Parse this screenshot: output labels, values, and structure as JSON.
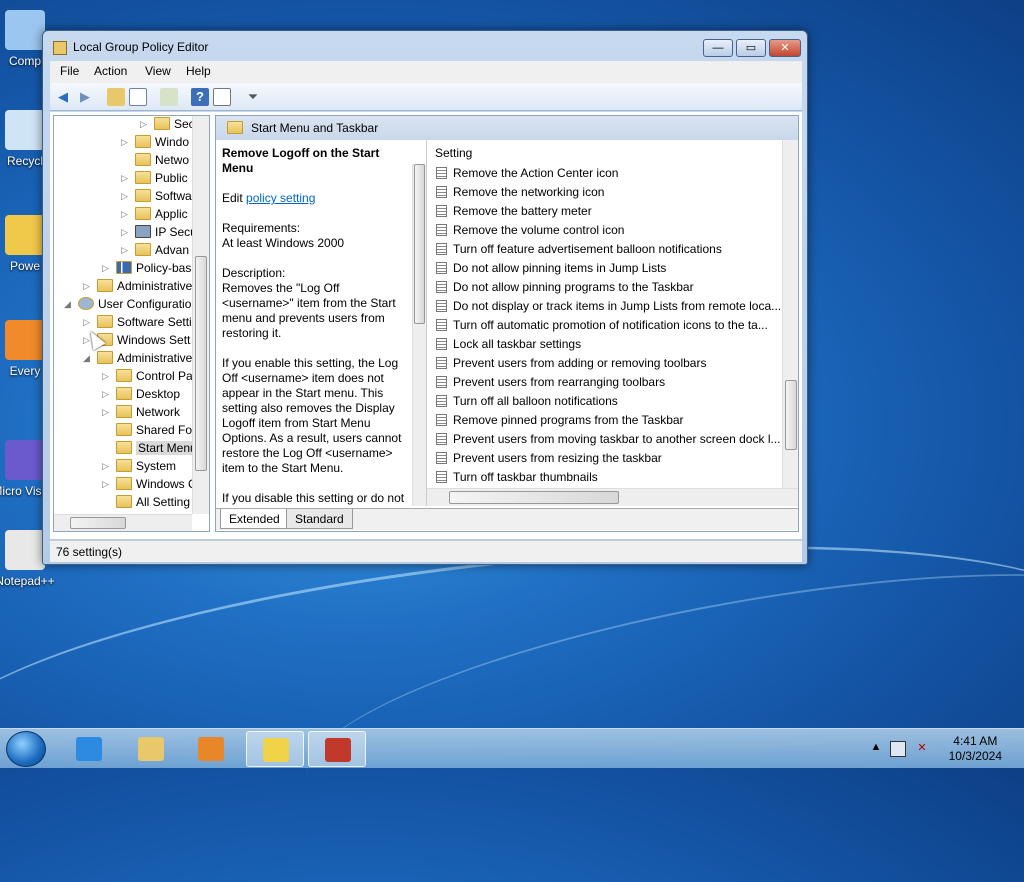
{
  "desktop": {
    "icons": [
      {
        "label": "Comp",
        "color": "#9bc6ef"
      },
      {
        "label": "Recycl",
        "color": "#cfe4f5"
      },
      {
        "label": "Powe",
        "color": "#f1c94a"
      },
      {
        "label": "Every",
        "color": "#f08a2a"
      },
      {
        "label": "Micro Visual",
        "color": "#6a5acd"
      },
      {
        "label": "Notepad++",
        "color": "#e8e8e8"
      }
    ]
  },
  "window": {
    "title": "Local Group Policy Editor",
    "min_glyph": "—",
    "max_glyph": "▭",
    "close_glyph": "✕",
    "menu": [
      "File",
      "Action",
      "View",
      "Help"
    ],
    "toolbar_icons": [
      "back-icon",
      "forward-icon",
      "up-folder-icon",
      "show-hide-tree-icon",
      "export-list-icon",
      "help-icon",
      "properties-icon",
      "filter-icon"
    ]
  },
  "tree": {
    "items": [
      {
        "label": "Sec",
        "indent": 5,
        "arrow": "▷",
        "kind": "folder-lock"
      },
      {
        "label": "Windo",
        "indent": 4,
        "arrow": "▷",
        "kind": "folder"
      },
      {
        "label": "Netwo",
        "indent": 4,
        "arrow": "",
        "kind": "folder"
      },
      {
        "label": "Public",
        "indent": 4,
        "arrow": "▷",
        "kind": "folder"
      },
      {
        "label": "Softwa",
        "indent": 4,
        "arrow": "▷",
        "kind": "folder"
      },
      {
        "label": "Applic",
        "indent": 4,
        "arrow": "▷",
        "kind": "folder"
      },
      {
        "label": "IP Secu",
        "indent": 4,
        "arrow": "▷",
        "kind": "computer"
      },
      {
        "label": "Advan",
        "indent": 4,
        "arrow": "▷",
        "kind": "folder"
      },
      {
        "label": "Policy-bas",
        "indent": 3,
        "arrow": "▷",
        "kind": "chart"
      },
      {
        "label": "Administrative",
        "indent": 2,
        "arrow": "▷",
        "kind": "folder"
      },
      {
        "label": "User Configuratio",
        "indent": 1,
        "arrow": "◢",
        "kind": "user"
      },
      {
        "label": "Software Setti",
        "indent": 2,
        "arrow": "▷",
        "kind": "folder"
      },
      {
        "label": "Windows Sett",
        "indent": 2,
        "arrow": "▷",
        "kind": "folder"
      },
      {
        "label": "Administrative",
        "indent": 2,
        "arrow": "◢",
        "kind": "folder"
      },
      {
        "label": "Control Pa",
        "indent": 3,
        "arrow": "▷",
        "kind": "folder"
      },
      {
        "label": "Desktop",
        "indent": 3,
        "arrow": "▷",
        "kind": "folder"
      },
      {
        "label": "Network",
        "indent": 3,
        "arrow": "▷",
        "kind": "folder"
      },
      {
        "label": "Shared Fol",
        "indent": 3,
        "arrow": "",
        "kind": "folder"
      },
      {
        "label": "Start Menu",
        "indent": 3,
        "arrow": "",
        "kind": "folder",
        "selected": true
      },
      {
        "label": "System",
        "indent": 3,
        "arrow": "▷",
        "kind": "folder"
      },
      {
        "label": "Windows C",
        "indent": 3,
        "arrow": "▷",
        "kind": "folder"
      },
      {
        "label": "All Setting",
        "indent": 3,
        "arrow": "",
        "kind": "folder"
      }
    ]
  },
  "pane": {
    "header": "Start Menu and Taskbar",
    "desc_title": "Remove Logoff on the Start Menu",
    "edit_prefix": "Edit ",
    "edit_link": "policy setting ",
    "requirements_label": "Requirements:",
    "requirements_value": "At least Windows 2000",
    "description_label": "Description:",
    "description_1": "Removes the \"Log Off <username>\" item from the Start menu and prevents users from restoring it.",
    "description_2": "If you enable this setting, the Log Off <username> item does not appear in the Start menu. This setting also removes the Display Logoff item from Start Menu Options. As a result, users cannot restore the Log Off <username> item to the Start Menu.",
    "description_3": "If you disable this setting or do not configure it, users can use the",
    "column_header": "Setting",
    "settings": [
      "Remove the Action Center icon",
      "Remove the networking icon",
      "Remove the battery meter",
      "Remove the volume control icon",
      "Turn off feature advertisement balloon notifications",
      "Do not allow pinning items in Jump Lists",
      "Do not allow pinning programs to the Taskbar",
      "Do not display or track items in Jump Lists from remote loca...",
      "Turn off automatic promotion of notification icons to the ta...",
      "Lock all taskbar settings",
      "Prevent users from adding or removing toolbars",
      "Prevent users from rearranging toolbars",
      "Turn off all balloon notifications",
      "Remove pinned programs from the Taskbar",
      "Prevent users from moving taskbar to another screen dock l...",
      "Prevent users from resizing the taskbar",
      "Turn off taskbar thumbnails"
    ],
    "tabs": [
      "Extended",
      "Standard"
    ]
  },
  "status": {
    "text": "76 setting(s)"
  },
  "taskbar": {
    "apps": [
      {
        "name": "internet-explorer",
        "color": "#2c8be0",
        "active": false
      },
      {
        "name": "file-explorer",
        "color": "#e8c86a",
        "active": false
      },
      {
        "name": "media-player",
        "color": "#e8862a",
        "active": false
      },
      {
        "name": "policy-editor",
        "color": "#f1d34a",
        "active": true
      },
      {
        "name": "toolbox",
        "color": "#c0392b",
        "active": true
      }
    ],
    "time": "4:41 AM",
    "date": "10/3/2024"
  }
}
